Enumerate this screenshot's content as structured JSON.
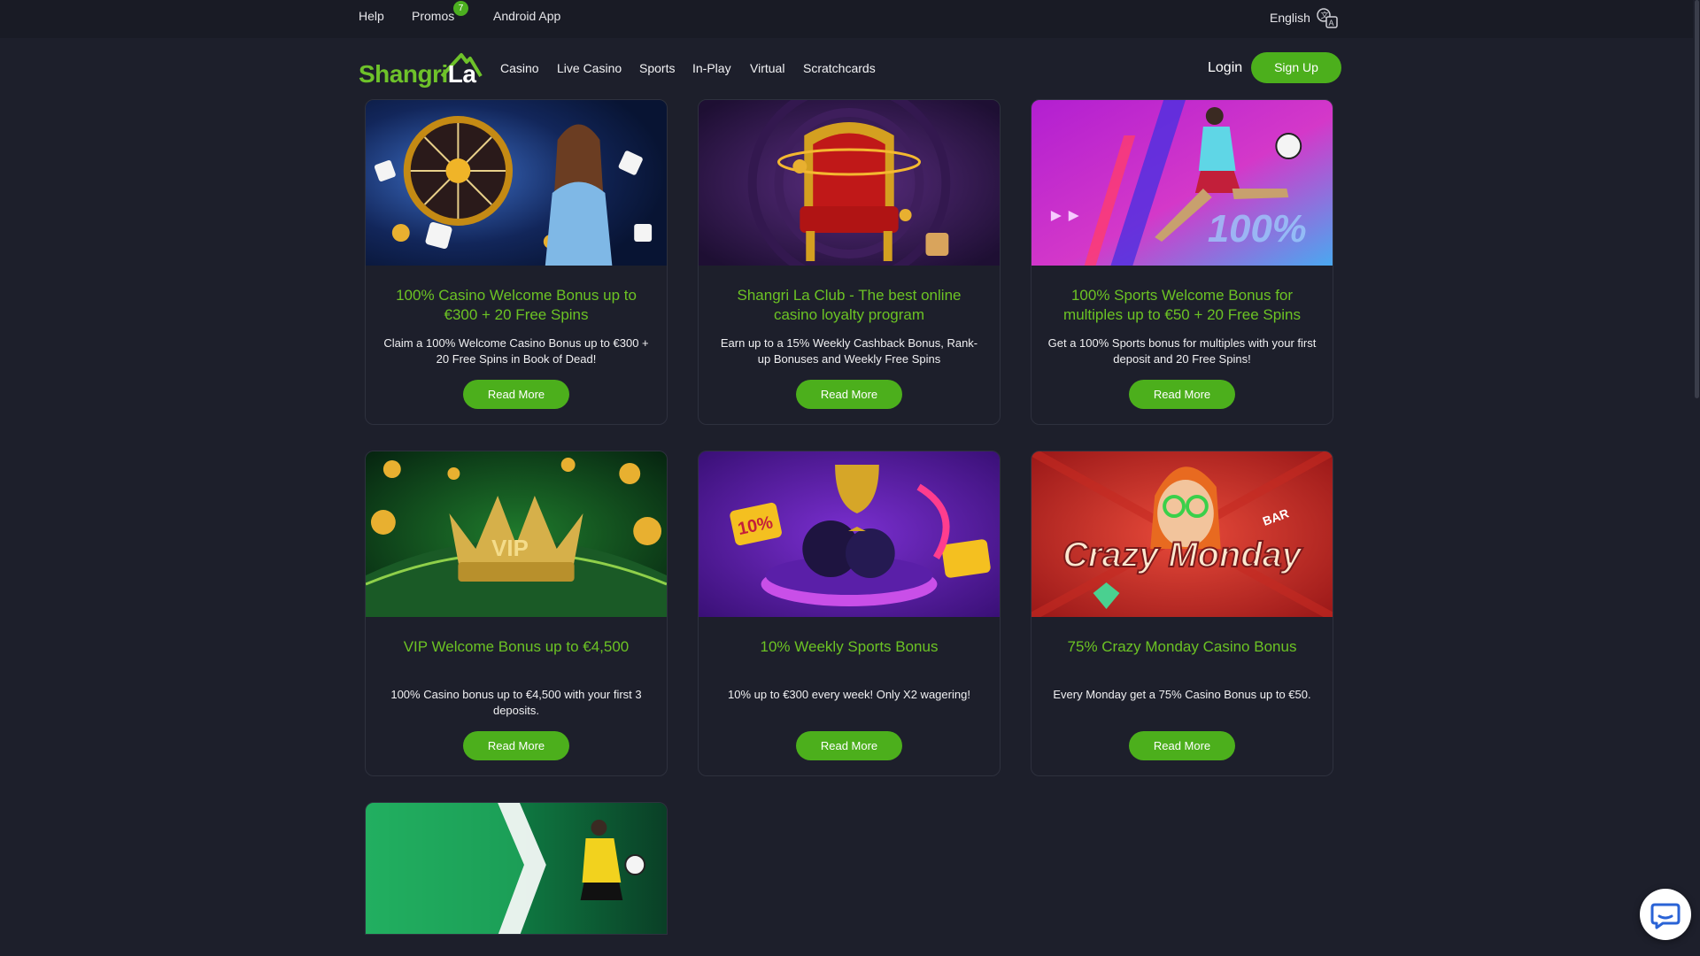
{
  "topbar": {
    "help": "Help",
    "promos": "Promos",
    "promos_badge": "7",
    "android_app": "Android App",
    "language": "English"
  },
  "logo": {
    "part1": "Shangri",
    "part2": "La"
  },
  "nav": {
    "items": [
      "Casino",
      "Live Casino",
      "Sports",
      "In-Play",
      "Virtual",
      "Scratchcards"
    ],
    "login": "Login",
    "signup": "Sign Up"
  },
  "promotions": [
    {
      "title": "100% Casino Welcome Bonus up to €300 + 20 Free Spins",
      "description": "Claim a 100% Welcome Casino Bonus up to €300 + 20 Free Spins in Book of Dead!",
      "button": "Read More"
    },
    {
      "title": "Shangri La Club - The best online casino loyalty program",
      "description": "Earn up to a 15% Weekly Cashback Bonus, Rank-up Bonuses and Weekly Free Spins",
      "button": "Read More"
    },
    {
      "title": "100% Sports Welcome Bonus for multiples up to €50 + 20 Free Spins",
      "description": "Get a 100% Sports bonus for multiples with your first deposit and 20 Free Spins!",
      "button": "Read More",
      "image_text": "100%"
    },
    {
      "title": "VIP Welcome Bonus up to €4,500",
      "description": "100% Casino bonus up to €4,500 with your first 3 deposits.",
      "button": "Read More",
      "image_text": "VIP"
    },
    {
      "title": "10% Weekly Sports Bonus",
      "description": "10% up to €300 every week! Only X2 wagering!",
      "button": "Read More",
      "image_text": "10%"
    },
    {
      "title": "75% Crazy Monday Casino Bonus",
      "description": "Every Monday get a 75% Casino Bonus up to €50.",
      "button": "Read More",
      "image_text": "Crazy Monday",
      "image_tag": "BAR"
    }
  ],
  "colors": {
    "accent_green": "#4caf1c",
    "title_green": "#6cc324",
    "background": "#1d1f2b"
  }
}
